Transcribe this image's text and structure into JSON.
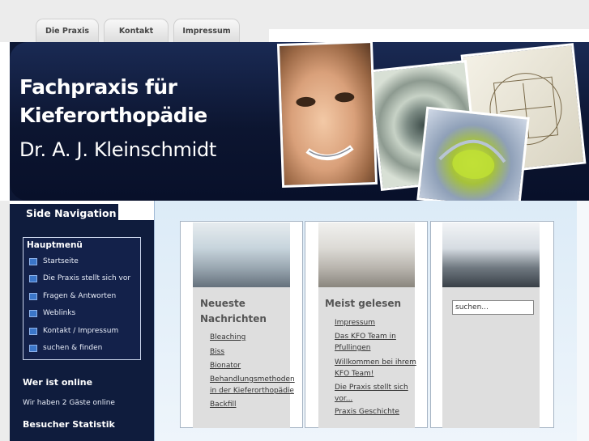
{
  "top_tabs": [
    "Die Praxis",
    "Kontakt",
    "Impressum"
  ],
  "header": {
    "line1": "Fachpraxis für",
    "line2": "Kieferorthopädie",
    "line3": "Dr. A. J. Kleinschmidt"
  },
  "sidebar": {
    "tab_label": "Side Navigation",
    "menu_title": "Hauptmenü",
    "menu_items": [
      "Startseite",
      "Die Praxis stellt sich vor",
      "Fragen & Antworten",
      "Weblinks",
      "Kontakt / Impressum",
      "suchen & finden"
    ],
    "online_title": "Wer ist online",
    "online_text": "Wir haben 2 Gäste online",
    "stats_title": "Besucher Statistik"
  },
  "columns": {
    "news_title_1": "Neueste",
    "news_title_2": "Nachrichten",
    "news_links": [
      "Bleaching",
      "Biss",
      "Bionator",
      "Behandlungsmethoden",
      "in der Kieferorthopädie",
      "Backfill"
    ],
    "popular_title": "Meist gelesen",
    "popular_links": [
      "Impressum",
      "Das KFO Team in",
      "Pfullingen",
      "Willkommen bei ihrem",
      "KFO Team!",
      "Die Praxis stellt sich",
      "vor...",
      "Praxis Geschichte"
    ],
    "search_value": "suchen..."
  }
}
